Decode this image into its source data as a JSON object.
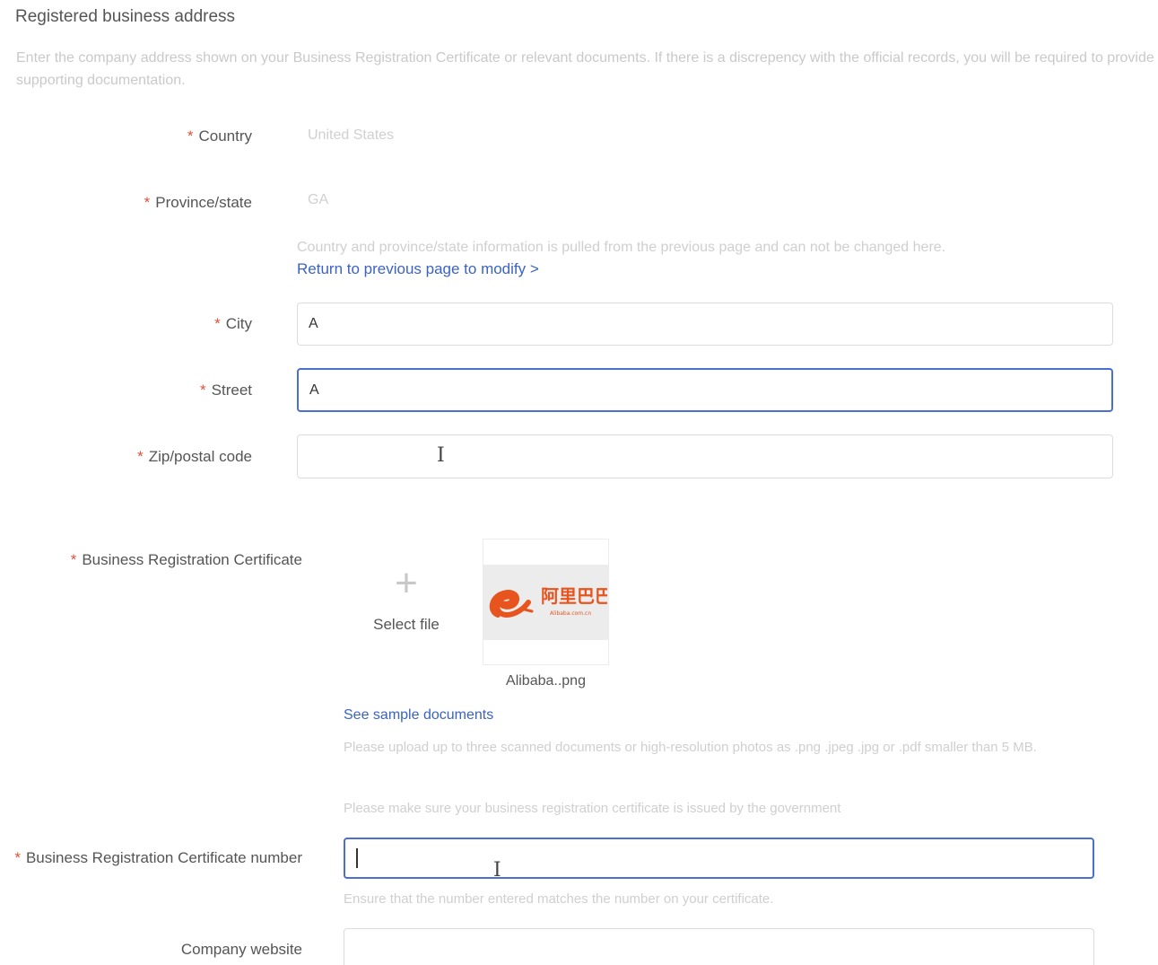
{
  "section": {
    "title": "Registered business address",
    "description": "Enter the company address shown on your Business Registration Certificate or relevant documents. If there is a discrepency with the official records, you will be required to provide supporting documentation."
  },
  "required_mark": "*",
  "fields": {
    "country": {
      "label": "Country",
      "value": "United States"
    },
    "province": {
      "label": "Province/state",
      "value": "GA"
    },
    "location_hint": "Country and province/state information is pulled from the previous page and can not be changed here.",
    "return_link": "Return to previous page to modify >",
    "city": {
      "label": "City",
      "value": "A"
    },
    "street": {
      "label": "Street",
      "value": "A"
    },
    "zip": {
      "label": "Zip/postal code",
      "value": ""
    }
  },
  "certificate": {
    "label": "Business Registration Certificate",
    "select_file": "Select file",
    "uploaded_file": "Alibaba..png",
    "sample_link": "See sample documents",
    "upload_hint": "Please upload up to three scanned documents or high-resolution photos as .png .jpeg .jpg or .pdf smaller than 5 MB.",
    "gov_hint": "Please make sure your business registration certificate is issued by the government"
  },
  "cert_number": {
    "label": "Business Registration Certificate number",
    "value": "",
    "hint": "Ensure that the number entered matches the number on your certificate."
  },
  "website": {
    "label": "Company website",
    "value": ""
  },
  "logo": {
    "text_cn": "阿里巴巴",
    "text_small": "Alibaba.com.cn",
    "brand_color": "#e8541e"
  },
  "colors": {
    "accent": "#4a6fd1",
    "link": "#3b63c4",
    "required": "#e0503a"
  }
}
